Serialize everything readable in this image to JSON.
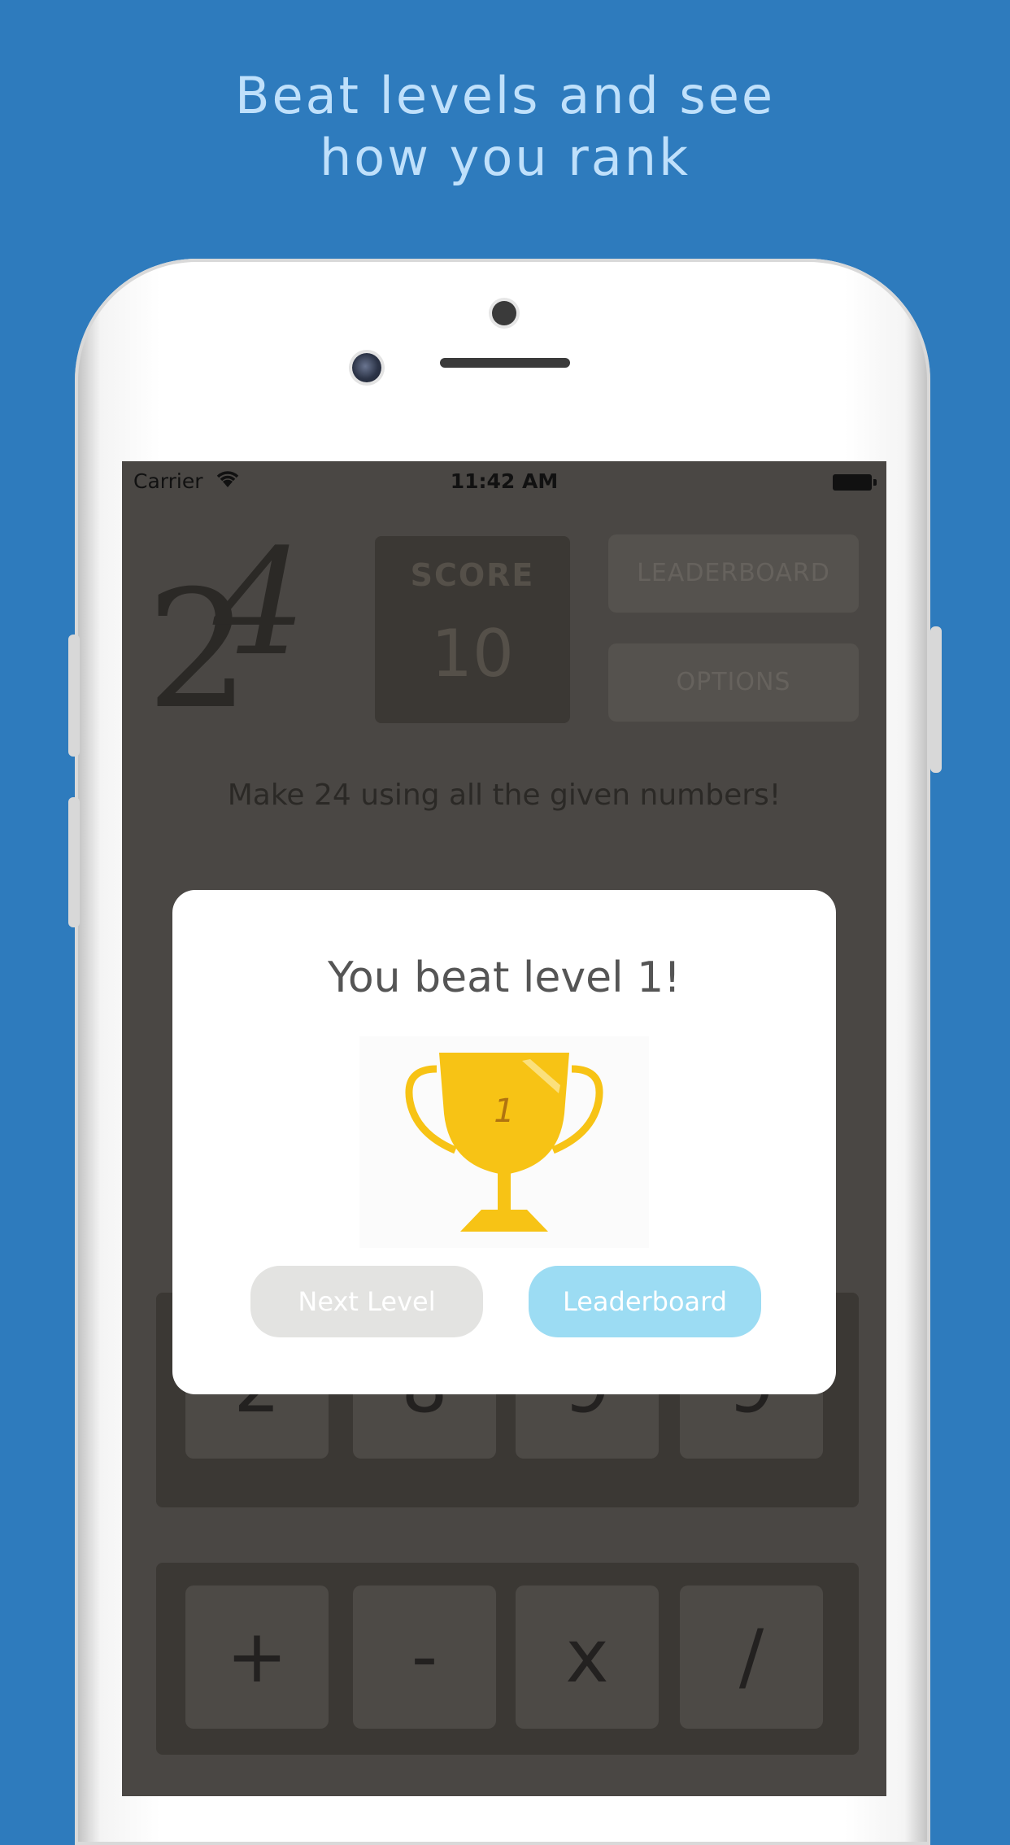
{
  "headline": {
    "line1": "Beat levels and see",
    "line2": "how you rank"
  },
  "status_bar": {
    "carrier": "Carrier",
    "time": "11:42 AM"
  },
  "game": {
    "logo": {
      "digit1": "2",
      "digit2": "4"
    },
    "score_label": "SCORE",
    "score_value": "10",
    "leaderboard_label": "LEADERBOARD",
    "options_label": "OPTIONS",
    "instruction": "Make 24 using all the given numbers!",
    "numbers": [
      "2",
      "8",
      "9",
      "9"
    ],
    "operators": [
      "+",
      "-",
      "x",
      "/"
    ]
  },
  "modal": {
    "title": "You beat level 1!",
    "trophy_number": "1",
    "next_label": "Next Level",
    "leaderboard_label": "Leaderboard"
  },
  "colors": {
    "background": "#2e7bbd",
    "headline_text": "#bfe0fb",
    "screen_dim": "#4a4744",
    "trophy_gold": "#f7c315",
    "leaderboard_button": "#9cdcf3",
    "next_button": "#e3e3e1"
  }
}
